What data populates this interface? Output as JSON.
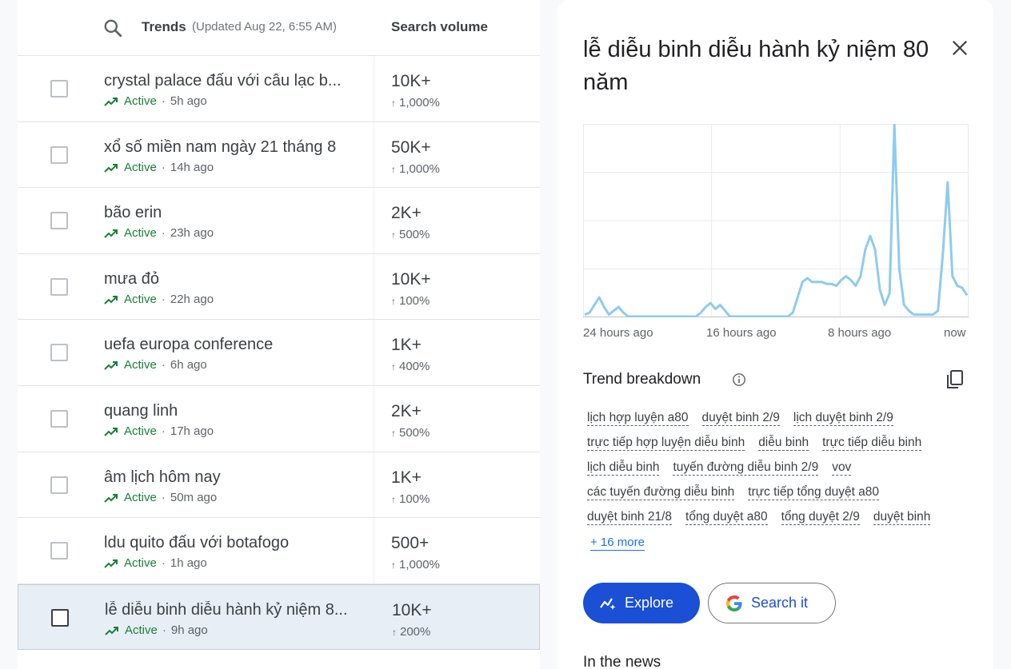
{
  "header": {
    "trends_label": "Trends",
    "updated": "(Updated Aug 22, 6:55 AM)",
    "volume_label": "Search volume"
  },
  "rows": [
    {
      "title": "crystal palace đấu với câu lạc b...",
      "status": "Active",
      "age": "5h ago",
      "volume": "10K+",
      "pct": "1,000%"
    },
    {
      "title": "xổ số miền nam ngày 21 tháng 8",
      "status": "Active",
      "age": "14h ago",
      "volume": "50K+",
      "pct": "1,000%"
    },
    {
      "title": "bão erin",
      "status": "Active",
      "age": "23h ago",
      "volume": "2K+",
      "pct": "500%"
    },
    {
      "title": "mưa đỏ",
      "status": "Active",
      "age": "22h ago",
      "volume": "10K+",
      "pct": "100%"
    },
    {
      "title": "uefa europa conference",
      "status": "Active",
      "age": "6h ago",
      "volume": "1K+",
      "pct": "400%"
    },
    {
      "title": "quang linh",
      "status": "Active",
      "age": "17h ago",
      "volume": "2K+",
      "pct": "500%"
    },
    {
      "title": "âm lịch hôm nay",
      "status": "Active",
      "age": "50m ago",
      "volume": "1K+",
      "pct": "100%"
    },
    {
      "title": "ldu quito đấu với botafogo",
      "status": "Active",
      "age": "1h ago",
      "volume": "500+",
      "pct": "1,000%"
    },
    {
      "title": "lễ diễu binh diễu hành kỷ niệm 8...",
      "status": "Active",
      "age": "9h ago",
      "volume": "10K+",
      "pct": "200%"
    }
  ],
  "detail": {
    "title": "lễ diễu binh diễu hành kỷ niệm 80 năm",
    "x_labels": [
      "24 hours ago",
      "16 hours ago",
      "8 hours ago",
      "now"
    ],
    "breakdown_title": "Trend breakdown",
    "chips": [
      [
        "lịch hợp luyện a80",
        "duyệt binh 2/9",
        "lịch duyệt binh 2/9"
      ],
      [
        "trực tiếp hợp luyện diễu binh",
        "diễu binh",
        "trực tiếp diễu binh"
      ],
      [
        "lịch diễu binh",
        "tuyến đường diễu binh 2/9",
        "vov"
      ],
      [
        "các tuyến đường diễu binh",
        "trực tiếp tổng duyệt a80"
      ],
      [
        "duyệt binh 21/8",
        "tổng duyệt a80",
        "tổng duyệt 2/9",
        "duyệt binh"
      ]
    ],
    "more_label": "+ 16 more",
    "explore_label": "Explore",
    "searchit_label": "Search it",
    "news_title": "In the news",
    "line_color": "#8ecbf0"
  },
  "chart_data": {
    "type": "line",
    "xlabel": "",
    "ylabel": "",
    "x_tick_labels": [
      "24 hours ago",
      "16 hours ago",
      "8 hours ago",
      "now"
    ],
    "ylim": [
      0,
      100
    ],
    "values": [
      1,
      2,
      6,
      10,
      5,
      1,
      3,
      5,
      2,
      0,
      0,
      0,
      0,
      0,
      0,
      0,
      0,
      0,
      0,
      0,
      0,
      0,
      0,
      0,
      2,
      5,
      7,
      4,
      6,
      3,
      0,
      0,
      0,
      0,
      0,
      0,
      0,
      0,
      0,
      0,
      0,
      0,
      0,
      2,
      10,
      18,
      20,
      18,
      18,
      18,
      17,
      17,
      16,
      19,
      21,
      19,
      16,
      21,
      35,
      42,
      35,
      14,
      6,
      12,
      100,
      25,
      6,
      3,
      1,
      1,
      1,
      1,
      1,
      3,
      32,
      70,
      21,
      16,
      15,
      11
    ]
  }
}
